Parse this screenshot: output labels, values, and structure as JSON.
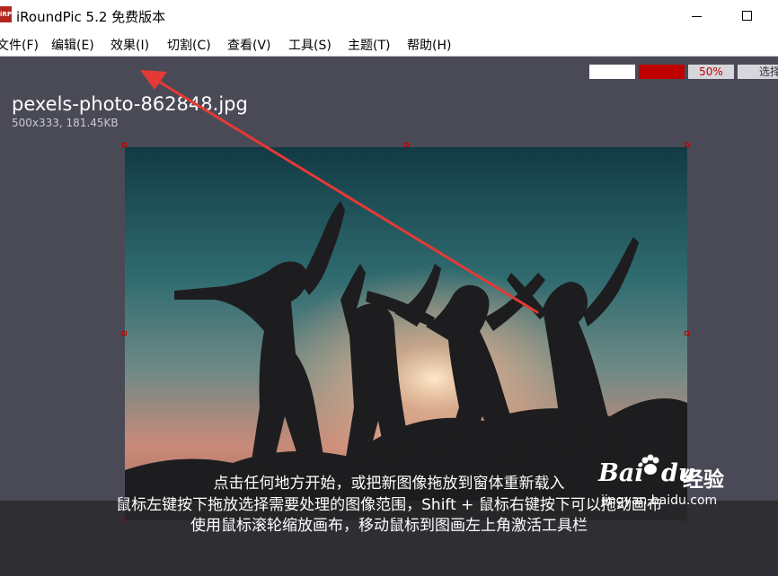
{
  "window": {
    "logo_text": "iRP",
    "title": "iRoundPic 5.2 免费版本"
  },
  "menu": [
    {
      "label": "文件(F)"
    },
    {
      "label": "编辑(E)"
    },
    {
      "label": "效果(I)"
    },
    {
      "label": "切割(C)"
    },
    {
      "label": "查看(V)"
    },
    {
      "label": "工具(S)"
    },
    {
      "label": "主题(T)"
    },
    {
      "label": "帮助(H)"
    }
  ],
  "toolbar": {
    "zoom": "50%",
    "select_label": "选择",
    "colors": {
      "swatch_1": "#ffffff",
      "swatch_2": "#c00000"
    }
  },
  "file": {
    "name": "pexels-photo-862848.jpg",
    "meta": "500x333, 181.45KB"
  },
  "hints": [
    "点击任何地方开始，或把新图像拖放到窗体重新载入",
    "鼠标左键按下拖放选择需要处理的图像范围，Shift + 鼠标右键按下可以拖动画布",
    "使用鼠标滚轮缩放画布，移动鼠标到图画左上角激活工具栏"
  ],
  "watermark": {
    "brand_left": "Bai",
    "brand_right": "du",
    "product": "经验",
    "url": "jingyan.baidu.com"
  },
  "annotation": {
    "color": "#e53935"
  }
}
